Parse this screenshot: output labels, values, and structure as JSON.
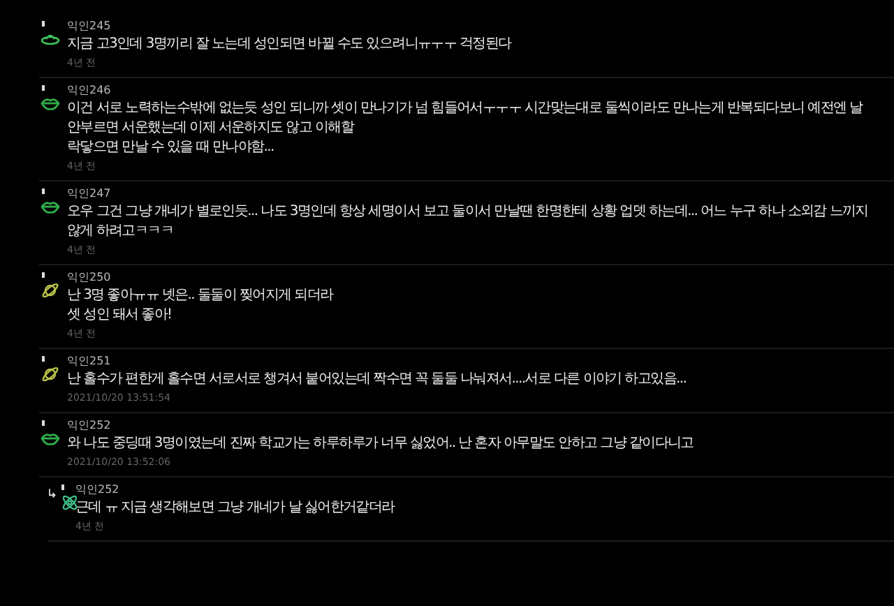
{
  "comments": [
    {
      "author": "익인245",
      "kind": "ufo",
      "reply": false,
      "lines": [
        "지금 고3인데 3명끼리 잘 노는데 성인되면 바뀔 수도 있으려니ㅠㅜㅜ 걱정된다"
      ],
      "time": "4년 전"
    },
    {
      "author": "익인246",
      "kind": "lips",
      "reply": false,
      "lines": [
        "이건 서로 노력하는수밖에 없는듯 성인 되니까 셋이 만나기가 넘 힘들어서ㅜㅜㅜ 시간맞는대로 둘씩이라도 만나는게 반복되다보니 예전엔 날 안부르면 서운했는데 이제 서운하지도 않고 이해할",
        "락닿으면 만날 수 있을 때 만나야함..."
      ],
      "time": "4년 전"
    },
    {
      "author": "익인247",
      "kind": "lips",
      "reply": false,
      "lines": [
        "오우 그건 그냥 개네가 별로인듯... 나도 3명인데 항상 세명이서 보고 둘이서 만날땐 한명한테 상황 업뎃 하는데... 어느 누구 하나 소외감 느끼지 않게 하려고ㅋㅋㅋ"
      ],
      "time": "4년 전"
    },
    {
      "author": "익인250",
      "kind": "planet",
      "reply": false,
      "lines": [
        "난 3명 좋아ㅠㅠ 넷은.. 둘둘이 찢어지게 되더라",
        "셋 성인 돼서 좋아!"
      ],
      "time": "4년 전"
    },
    {
      "author": "익인251",
      "kind": "planet",
      "reply": false,
      "lines": [
        "난 홀수가 편한게 홀수면 서로서로 챙겨서 붙어있는데 짝수면 꼭 둘둘 나눠져서....서로 다른 이야기 하고있음..."
      ],
      "time": "2021/10/20 13:51:54"
    },
    {
      "author": "익인252",
      "kind": "lips",
      "reply": false,
      "lines": [
        "와 나도 중딩때 3명이였는데 진짜 학교가는 하루하루가 너무 싫었어.. 난 혼자 아무말도 안하고 그냥 같이다니고"
      ],
      "time": "2021/10/20 13:52:06"
    },
    {
      "author": "익인252",
      "kind": "atom",
      "reply": true,
      "lines": [
        "근데 ㅠ 지금 생각해보면 그냥 개네가 날 싫어한거같더라"
      ],
      "time": "4년 전"
    }
  ]
}
